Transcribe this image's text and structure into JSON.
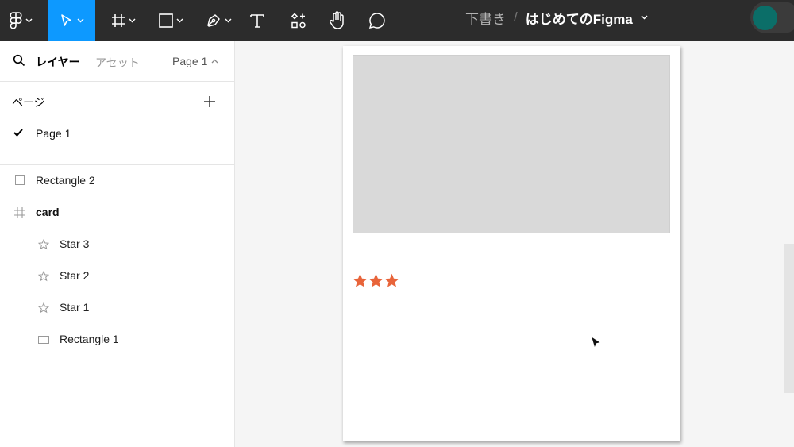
{
  "toolbar": {
    "icons": [
      "figma-logo-icon",
      "move-tool-icon",
      "frame-tool-icon",
      "rectangle-tool-icon",
      "pen-tool-icon",
      "text-tool-icon",
      "resources-icon",
      "hand-tool-icon",
      "comment-icon"
    ],
    "active_tool": "move-tool",
    "breadcrumb": "下書き",
    "separator": "/",
    "file_name": "はじめてのFigma",
    "colors": {
      "bar": "#2c2c2c",
      "active": "#0d99ff",
      "avatar": "#0b6e68"
    }
  },
  "panel": {
    "tabs": {
      "layers": "レイヤー",
      "assets": "アセット"
    },
    "current_page": "Page 1",
    "pages_title": "ページ",
    "pages": [
      {
        "label": "Page 1",
        "selected": true
      }
    ],
    "layers": [
      {
        "label": "Rectangle 2",
        "icon": "square-icon",
        "indent": 0
      },
      {
        "label": "card",
        "icon": "frame-icon",
        "indent": 0,
        "bold": true
      },
      {
        "label": "Star 3",
        "icon": "star-icon",
        "indent": 1
      },
      {
        "label": "Star 2",
        "icon": "star-icon",
        "indent": 1
      },
      {
        "label": "Star 1",
        "icon": "star-icon",
        "indent": 1
      },
      {
        "label": "Rectangle 1",
        "icon": "rectangle-icon",
        "indent": 1
      }
    ]
  },
  "canvas": {
    "star_count": 3,
    "star_color": "#e8643a",
    "image_placeholder_color": "#d9d9d9",
    "background": "#f5f5f5"
  }
}
